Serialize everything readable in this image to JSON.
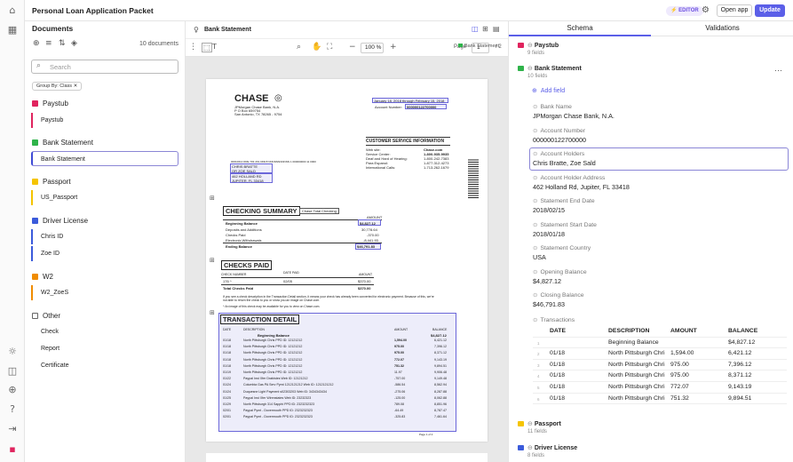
{
  "app": {
    "title": "Personal Loan Application Packet",
    "editor_badge": "⚡ EDITOR",
    "open_app": "Open app",
    "update": "Update"
  },
  "documents": {
    "title": "Documents",
    "count": "10 documents",
    "search_placeholder": "Search",
    "group_chip": "Group By: Class ✕",
    "groups": [
      {
        "name": "Paystub",
        "color": "#e0245e",
        "items": [
          "Paystub"
        ]
      },
      {
        "name": "Bank Statement",
        "color": "#2fb34a",
        "items": [
          "Bank Statement"
        ]
      },
      {
        "name": "Passport",
        "color": "#f5c400",
        "items": [
          "US_Passport"
        ]
      },
      {
        "name": "Driver License",
        "color": "#3b5bdb",
        "items": [
          "Chris ID",
          "Zoe ID"
        ]
      },
      {
        "name": "W2",
        "color": "#f08c00",
        "items": [
          "W2_ZoeS"
        ]
      },
      {
        "name": "Other",
        "color": "",
        "items": [
          "Check",
          "Report",
          "Certificate"
        ]
      }
    ]
  },
  "viewer": {
    "title": "Bank Statement",
    "tag": "Bank Statement",
    "zoom": "100 %",
    "page_label": "Page",
    "page": "1",
    "page_of": "/ 2"
  },
  "statement": {
    "bank": "CHASE",
    "bank_addr": [
      "JPMorgan Chase Bank, N.A.",
      "P O Box 659754",
      "San Antonio, TX 78265 - 9754"
    ],
    "period": "January 18, 2018 through February 15, 2018",
    "acct_label": "Account Number:",
    "acct": "000000122700000",
    "csi_title": "CUSTOMER SERVICE INFORMATION",
    "csi": [
      [
        "Web site:",
        "Chase.com"
      ],
      [
        "Service Center:",
        "1-800-935-9935"
      ],
      [
        "Deaf and Hard of Hearing:",
        "1-800-242-7383"
      ],
      [
        "Para Espanol:",
        "1-877-312-4273"
      ],
      [
        "International Calls:",
        "1-713-262-1679"
      ]
    ],
    "addr_code": "00010014 DRE 703 219 04918 NNNNNNNNNNN 1 000000000 11 0000",
    "holder": [
      "CHRIS BRATTE",
      "OR ZOE SALD",
      "462 HOLLAND RD",
      "JUPITER, FL 33418"
    ],
    "checking_title": "CHECKING SUMMARY",
    "checking_tag": "Chase Total Checking",
    "amount_col": "AMOUNT",
    "checking_rows": [
      [
        "Beginning Balance",
        "$4,827.12"
      ],
      [
        "Deposits and Additions",
        "30,778.64"
      ],
      [
        "Checks Paid",
        "-370.00"
      ],
      [
        "Electronic Withdrawals",
        "-8,441.93"
      ],
      [
        "Ending Balance",
        "$46,791.83"
      ]
    ],
    "checks_title": "CHECKS PAID",
    "checks_cols": [
      "CHECK NUMBER",
      "DATE PAID",
      "AMOUNT"
    ],
    "checks_row": [
      "176 ^",
      "02/05",
      "$370.00"
    ],
    "checks_total": [
      "Total Checks Paid",
      "$370.00"
    ],
    "checks_note": "If you see a check description in the Transaction Detail section, it means your check has already been converted for electronic payment. Because of this, we're not able to return the check to you or show you an image on Chase.com.",
    "checks_note2": "^ An image of this check may be available for you to view on Chase.com.",
    "tx_title": "TRANSACTION DETAIL",
    "tx_cols": [
      "DATE",
      "DESCRIPTION",
      "AMOUNT",
      "BALANCE"
    ],
    "tx_begin": [
      "Beginning Balance",
      "$4,827.12"
    ],
    "tx_rows": [
      [
        "01/18",
        "North Pittsburgh Chris       PPD ID: 12121212",
        "1,594.00",
        "6,421.12"
      ],
      [
        "01/18",
        "North Pittsburgh Chris       PPD ID: 12121212",
        "975.00",
        "7,396.12"
      ],
      [
        "01/18",
        "North Pittsburgh Chris       PPD ID: 12121212",
        "975.00",
        "8,371.12"
      ],
      [
        "01/18",
        "North Pittsburgh Chris       PPD ID: 12121212",
        "772.07",
        "9,143.19"
      ],
      [
        "01/18",
        "North Pittsburgh Chris       PPD ID: 12121212",
        "751.32",
        "9,894.51"
      ],
      [
        "01/19",
        "North Pittsburgh Chris       PPD ID: 12121212",
        "11.97",
        "9,906.48"
      ],
      [
        "01/22",
        "Paypal        Inst Xfer Drabistes       Web ID: 12121212",
        "-757.00",
        "9,149.48"
      ],
      [
        "01/24",
        "Columbia Gas PA  Serv Pymt  1212121212  Web ID: 1212121212",
        "-586.54",
        "8,562.94"
      ],
      [
        "01/24",
        "Duquesne Light  Payment  s02303203  Web ID: 3434343434",
        "-275.06",
        "8,287.88"
      ],
      [
        "01/25",
        "Paypal       Inst Xfer  Wirenstates  Web ID: 23232323",
        "-125.00",
        "8,062.88"
      ],
      [
        "01/29",
        "North Pittsburgh 314 Sapphi        PPD ID: 2323232323",
        "789.08",
        "8,851.96"
      ],
      [
        "02/01",
        "Paypal Pymt  - Dovermouth        PPD ID: 2323232323",
        "-64.49",
        "8,787.47"
      ],
      [
        "02/01",
        "Paypal Pymt  - Dovermouth        PPD ID: 2323232323",
        "-325.83",
        "7,461.64"
      ]
    ],
    "page_foot": "Page 1 of 2"
  },
  "schema": {
    "tab_schema": "Schema",
    "tab_validations": "Validations",
    "paystub": {
      "name": "Paystub",
      "fields": "9 fields"
    },
    "bank": {
      "name": "Bank Statement",
      "fields": "10 fields"
    },
    "add_field": "Add field",
    "fields": [
      {
        "label": "Bank Name",
        "value": "JPMorgan Chase Bank, N.A."
      },
      {
        "label": "Account Number",
        "value": "000000122700000"
      },
      {
        "label": "Account Holders",
        "value": "Chris Bratte, Zoe Sald"
      },
      {
        "label": "Account Holder Address",
        "value": "462 Holland Rd, Jupiter, FL 33418"
      },
      {
        "label": "Statement End Date",
        "value": "2018/02/15"
      },
      {
        "label": "Statement Start Date",
        "value": "2018/01/18"
      },
      {
        "label": "Statement Country",
        "value": "USA"
      },
      {
        "label": "Opening Balance",
        "value": "$4,827.12"
      },
      {
        "label": "Closing Balance",
        "value": "$46,791.83"
      }
    ],
    "transactions_label": "Transactions",
    "tx_cols": [
      "DATE",
      "DESCRIPTION",
      "AMOUNT",
      "BALANCE"
    ],
    "tx_rows": [
      [
        "1",
        "",
        "Beginning Balance",
        "",
        "$4,827.12"
      ],
      [
        "2",
        "01/18",
        "North Pittsburgh Chri",
        "1,594.00",
        "6,421.12"
      ],
      [
        "3",
        "01/18",
        "North Pittsburgh Chri",
        "975.00",
        "7,396.12"
      ],
      [
        "4",
        "01/18",
        "North Pittsburgh Chri",
        "975.00",
        "8,371.12"
      ],
      [
        "5",
        "01/18",
        "North Pittsburgh Chri",
        "772.07",
        "9,143.19"
      ],
      [
        "6",
        "01/18",
        "North Pittsburgh Chri",
        "751.32",
        "9,894.51"
      ]
    ],
    "passport": {
      "name": "Passport",
      "fields": "11 fields"
    },
    "driver": {
      "name": "Driver License",
      "fields": "8 fields"
    }
  }
}
